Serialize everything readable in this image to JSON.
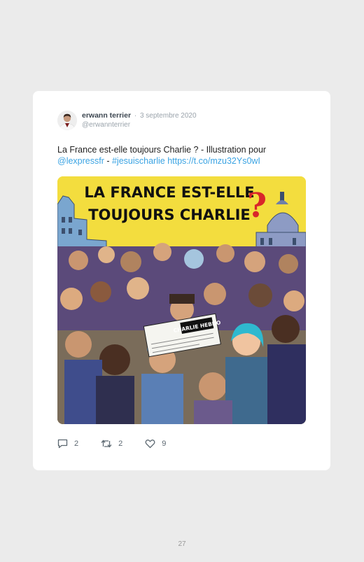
{
  "tweet": {
    "author_name": "erwann terrier",
    "separator": "·",
    "date": "3 septembre 2020",
    "handle": "@erwannterrier",
    "text_plain": "La France est-elle toujours Charlie ? - Illustration pour",
    "mention": "@lexpressfr",
    "text_dash": " - ",
    "hashtag": "#jesuischarlie",
    "url": "https://t.co/mzu32Ys0wI",
    "media": {
      "headline_line1": "LA FRANCE EST-ELLE",
      "headline_line2": "TOUJOURS CHARLIE",
      "question_mark": "?",
      "newspaper_title": "CHARLIE HEBDO"
    },
    "actions": {
      "replies": "2",
      "retweets": "2",
      "likes": "9"
    }
  },
  "page": {
    "number": "27"
  },
  "colors": {
    "link": "#3aa3e3",
    "poster_background": "#f3dd3e",
    "question_mark": "#d9262a"
  }
}
